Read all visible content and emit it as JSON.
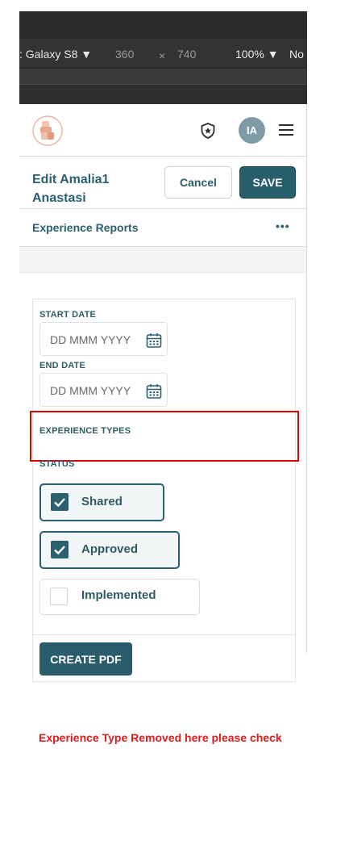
{
  "devtools": {
    "device": ": Galaxy S8",
    "width": "360",
    "times": "×",
    "height": "740",
    "zoom": "100%",
    "throttle": "No"
  },
  "header": {
    "avatar_initials": "IA",
    "icons": [
      "logo",
      "shield-star-icon",
      "hamburger-menu-icon"
    ]
  },
  "page": {
    "title_line1": "Edit Amalia1",
    "title_line2": "Anastasi",
    "cancel_label": "Cancel",
    "save_label": "SAVE",
    "section_title": "Experience Reports",
    "more_label": "•••"
  },
  "form": {
    "start_date_label": "START DATE",
    "start_date_placeholder": "DD MMM YYYY",
    "end_date_label": "END DATE",
    "end_date_placeholder": "DD MMM YYYY",
    "experience_types_label": "EXPERIENCE TYPES",
    "status_label": "STATUS",
    "statuses": [
      {
        "label": "Shared",
        "checked": true
      },
      {
        "label": "Approved",
        "checked": true
      },
      {
        "label": "Implemented",
        "checked": false
      }
    ],
    "create_pdf_label": "CREATE PDF"
  },
  "annotation": {
    "note": "Experience Type Removed here please check"
  },
  "colors": {
    "accent": "#2a6070",
    "highlight": "#e00000"
  }
}
